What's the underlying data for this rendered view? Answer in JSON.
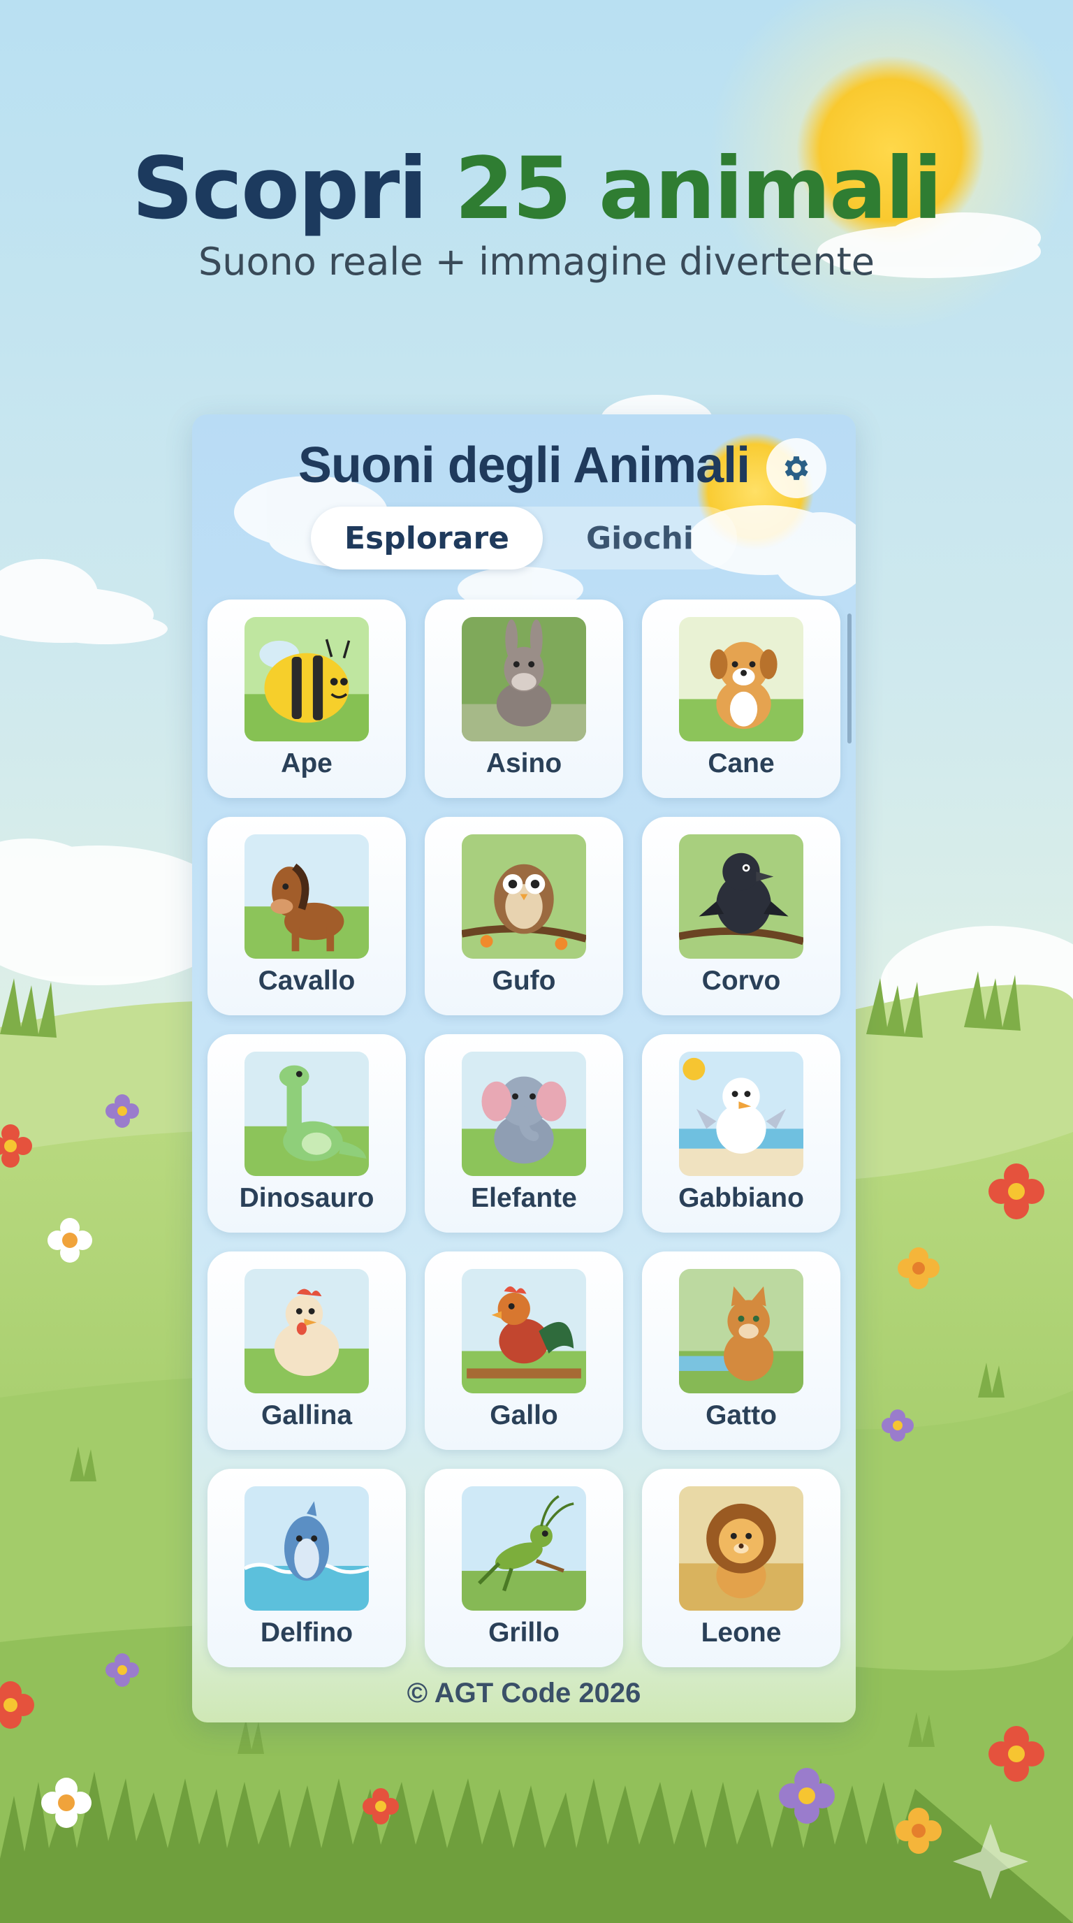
{
  "promo": {
    "headline_part1": "Scopri ",
    "headline_part2": "25 animali",
    "subheadline": "Suono reale + immagine divertente"
  },
  "app": {
    "title": "Suoni degli Animali",
    "settings_icon": "gear-icon",
    "tabs": [
      {
        "label": "Esplorare",
        "active": true
      },
      {
        "label": "Giochi",
        "active": false
      }
    ],
    "animals": [
      {
        "label": "Ape",
        "icon": "bee-icon"
      },
      {
        "label": "Asino",
        "icon": "donkey-icon"
      },
      {
        "label": "Cane",
        "icon": "dog-icon"
      },
      {
        "label": "Cavallo",
        "icon": "horse-icon"
      },
      {
        "label": "Gufo",
        "icon": "owl-icon"
      },
      {
        "label": "Corvo",
        "icon": "crow-icon"
      },
      {
        "label": "Dinosauro",
        "icon": "dinosaur-icon"
      },
      {
        "label": "Elefante",
        "icon": "elephant-icon"
      },
      {
        "label": "Gabbiano",
        "icon": "seagull-icon"
      },
      {
        "label": "Gallina",
        "icon": "hen-icon"
      },
      {
        "label": "Gallo",
        "icon": "rooster-icon"
      },
      {
        "label": "Gatto",
        "icon": "cat-icon"
      },
      {
        "label": "Delfino",
        "icon": "dolphin-icon"
      },
      {
        "label": "Grillo",
        "icon": "cricket-icon"
      },
      {
        "label": "Leone",
        "icon": "lion-icon"
      }
    ],
    "footer": "© AGT Code 2026"
  },
  "colors": {
    "title_navy": "#1f3a5c",
    "headline_green": "#2f7d32",
    "sky_top": "#bfe2f3",
    "grass": "#9cc660"
  }
}
